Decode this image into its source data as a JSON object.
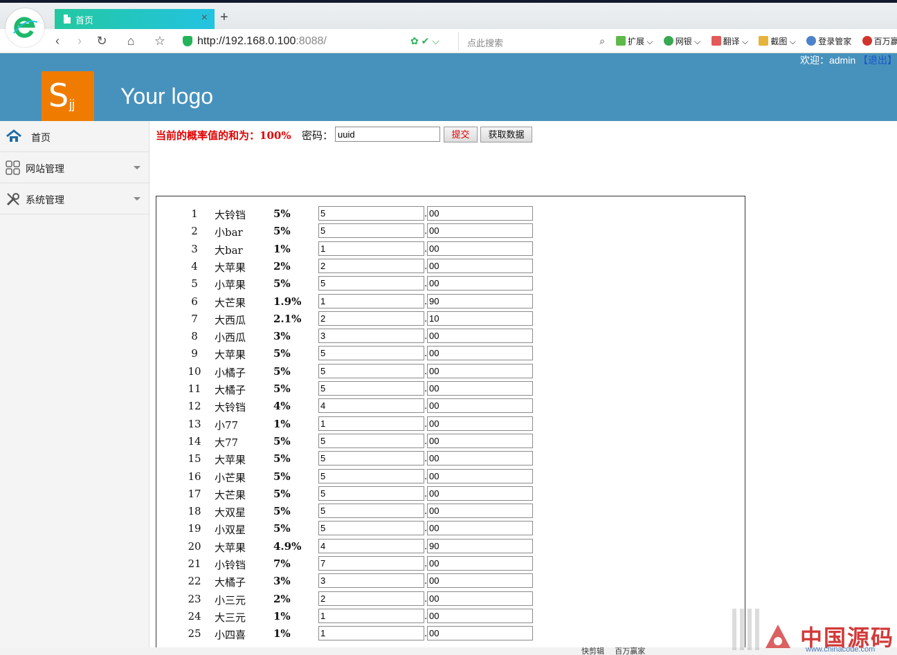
{
  "browser": {
    "tab_title": "首页",
    "tab_close": "×",
    "new_tab": "+",
    "url_main": "http://192.168.0.100",
    "url_port": ":8088/",
    "search_placeholder": "点此搜索",
    "toolbar": [
      "扩展",
      "网银",
      "翻译",
      "截图",
      "登录管家",
      "百万赢"
    ]
  },
  "header": {
    "logo_letter": "S",
    "logo_sub": "jj",
    "logo_text": "Your logo",
    "welcome": "欢迎：admin",
    "logout": "【退出】"
  },
  "sidebar": {
    "items": [
      {
        "label": "首页",
        "icon": "home-icon"
      },
      {
        "label": "网站管理",
        "icon": "grid-icon"
      },
      {
        "label": "系统管理",
        "icon": "tools-icon"
      }
    ]
  },
  "form": {
    "sum_label": "当前的概率值的和为：",
    "sum_value": "100%",
    "password_label": "密码：",
    "password_value": "uuid",
    "submit_label": "提交",
    "fetch_label": "获取数据"
  },
  "rows": [
    {
      "num": "1",
      "name": "大铃铛",
      "prob": "5%",
      "int": "5",
      "dec": "00"
    },
    {
      "num": "2",
      "name": "小bar",
      "prob": "5%",
      "int": "5",
      "dec": "00"
    },
    {
      "num": "3",
      "name": "大bar",
      "prob": "1%",
      "int": "1",
      "dec": "00"
    },
    {
      "num": "4",
      "name": "大苹果",
      "prob": "2%",
      "int": "2",
      "dec": "00"
    },
    {
      "num": "5",
      "name": "小苹果",
      "prob": "5%",
      "int": "5",
      "dec": "00"
    },
    {
      "num": "6",
      "name": "大芒果",
      "prob": "1.9%",
      "int": "1",
      "dec": "90"
    },
    {
      "num": "7",
      "name": "大西瓜",
      "prob": "2.1%",
      "int": "2",
      "dec": "10"
    },
    {
      "num": "8",
      "name": "小西瓜",
      "prob": "3%",
      "int": "3",
      "dec": "00"
    },
    {
      "num": "9",
      "name": "大苹果",
      "prob": "5%",
      "int": "5",
      "dec": "00"
    },
    {
      "num": "10",
      "name": "小橘子",
      "prob": "5%",
      "int": "5",
      "dec": "00"
    },
    {
      "num": "11",
      "name": "大橘子",
      "prob": "5%",
      "int": "5",
      "dec": "00"
    },
    {
      "num": "12",
      "name": "大铃铛",
      "prob": "4%",
      "int": "4",
      "dec": "00"
    },
    {
      "num": "13",
      "name": "小77",
      "prob": "1%",
      "int": "1",
      "dec": "00"
    },
    {
      "num": "14",
      "name": "大77",
      "prob": "5%",
      "int": "5",
      "dec": "00"
    },
    {
      "num": "15",
      "name": "大苹果",
      "prob": "5%",
      "int": "5",
      "dec": "00"
    },
    {
      "num": "16",
      "name": "小芒果",
      "prob": "5%",
      "int": "5",
      "dec": "00"
    },
    {
      "num": "17",
      "name": "大芒果",
      "prob": "5%",
      "int": "5",
      "dec": "00"
    },
    {
      "num": "18",
      "name": "大双星",
      "prob": "5%",
      "int": "5",
      "dec": "00"
    },
    {
      "num": "19",
      "name": "小双星",
      "prob": "5%",
      "int": "5",
      "dec": "00"
    },
    {
      "num": "20",
      "name": "大苹果",
      "prob": "4.9%",
      "int": "4",
      "dec": "90"
    },
    {
      "num": "21",
      "name": "小铃铛",
      "prob": "7%",
      "int": "7",
      "dec": "00"
    },
    {
      "num": "22",
      "name": "大橘子",
      "prob": "3%",
      "int": "3",
      "dec": "00"
    },
    {
      "num": "23",
      "name": "小三元",
      "prob": "2%",
      "int": "2",
      "dec": "00"
    },
    {
      "num": "24",
      "name": "大三元",
      "prob": "1%",
      "int": "1",
      "dec": "00"
    },
    {
      "num": "25",
      "name": "小四喜",
      "prob": "1%",
      "int": "1",
      "dec": "00"
    }
  ],
  "statusbar": {
    "items": [
      "快剪辑",
      "百万赢家"
    ]
  },
  "watermark": {
    "text": "中国源码",
    "url": "www.chinacode.com"
  },
  "colors": {
    "header_bg": "#4792bd",
    "logo_bg": "#ef7c00",
    "accent_red": "#e00000",
    "tab_gradient_start": "#23c8a0",
    "tab_gradient_end": "#23c3e2"
  }
}
